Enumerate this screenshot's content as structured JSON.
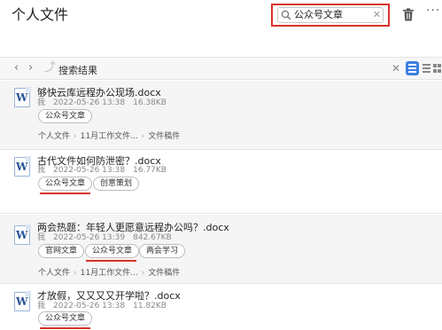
{
  "header": {
    "title": "个人文件",
    "search_value": "公众号文章",
    "more": "···"
  },
  "toolbar": {
    "back": "‹",
    "forward": "›",
    "up": "⤴",
    "breadcrumb": "搜索结果",
    "close": "✕"
  },
  "results": [
    {
      "name": "够快云库远程办公现场.docx",
      "owner": "我",
      "date": "2022-05-26 13:38",
      "size": "16.38KB",
      "tags": [
        "公众号文章"
      ],
      "path": [
        "个人文件",
        "11月工作文件...",
        "文件稿件"
      ]
    },
    {
      "name": "古代文件如何防泄密？.docx",
      "owner": "我",
      "date": "2022-05-26 13:38",
      "size": "16.77KB",
      "tags": [
        "公众号文章",
        "创意策划"
      ]
    },
    {
      "name": "两会热题：年轻人更愿意远程办公吗？.docx",
      "owner": "我",
      "date": "2022-05-26 13:39",
      "size": "842.67KB",
      "tags": [
        "官网文章",
        "公众号文章",
        "两会学习"
      ],
      "path": [
        "个人文件",
        "11月工作文件...",
        "文件稿件"
      ]
    },
    {
      "name": "才放假，又又又又开学啦？.docx",
      "owner": "我",
      "date": "2022-05-26 13:38",
      "size": "11.82KB",
      "tags": [
        "公众号文章"
      ]
    }
  ],
  "colors": {
    "highlight": "#d9302c",
    "accent": "#3d7fe0",
    "doc_icon": "#2a5699"
  },
  "icons": {
    "search": "magnifier-icon",
    "trash": "trash-icon",
    "file": "word-doc-icon"
  }
}
